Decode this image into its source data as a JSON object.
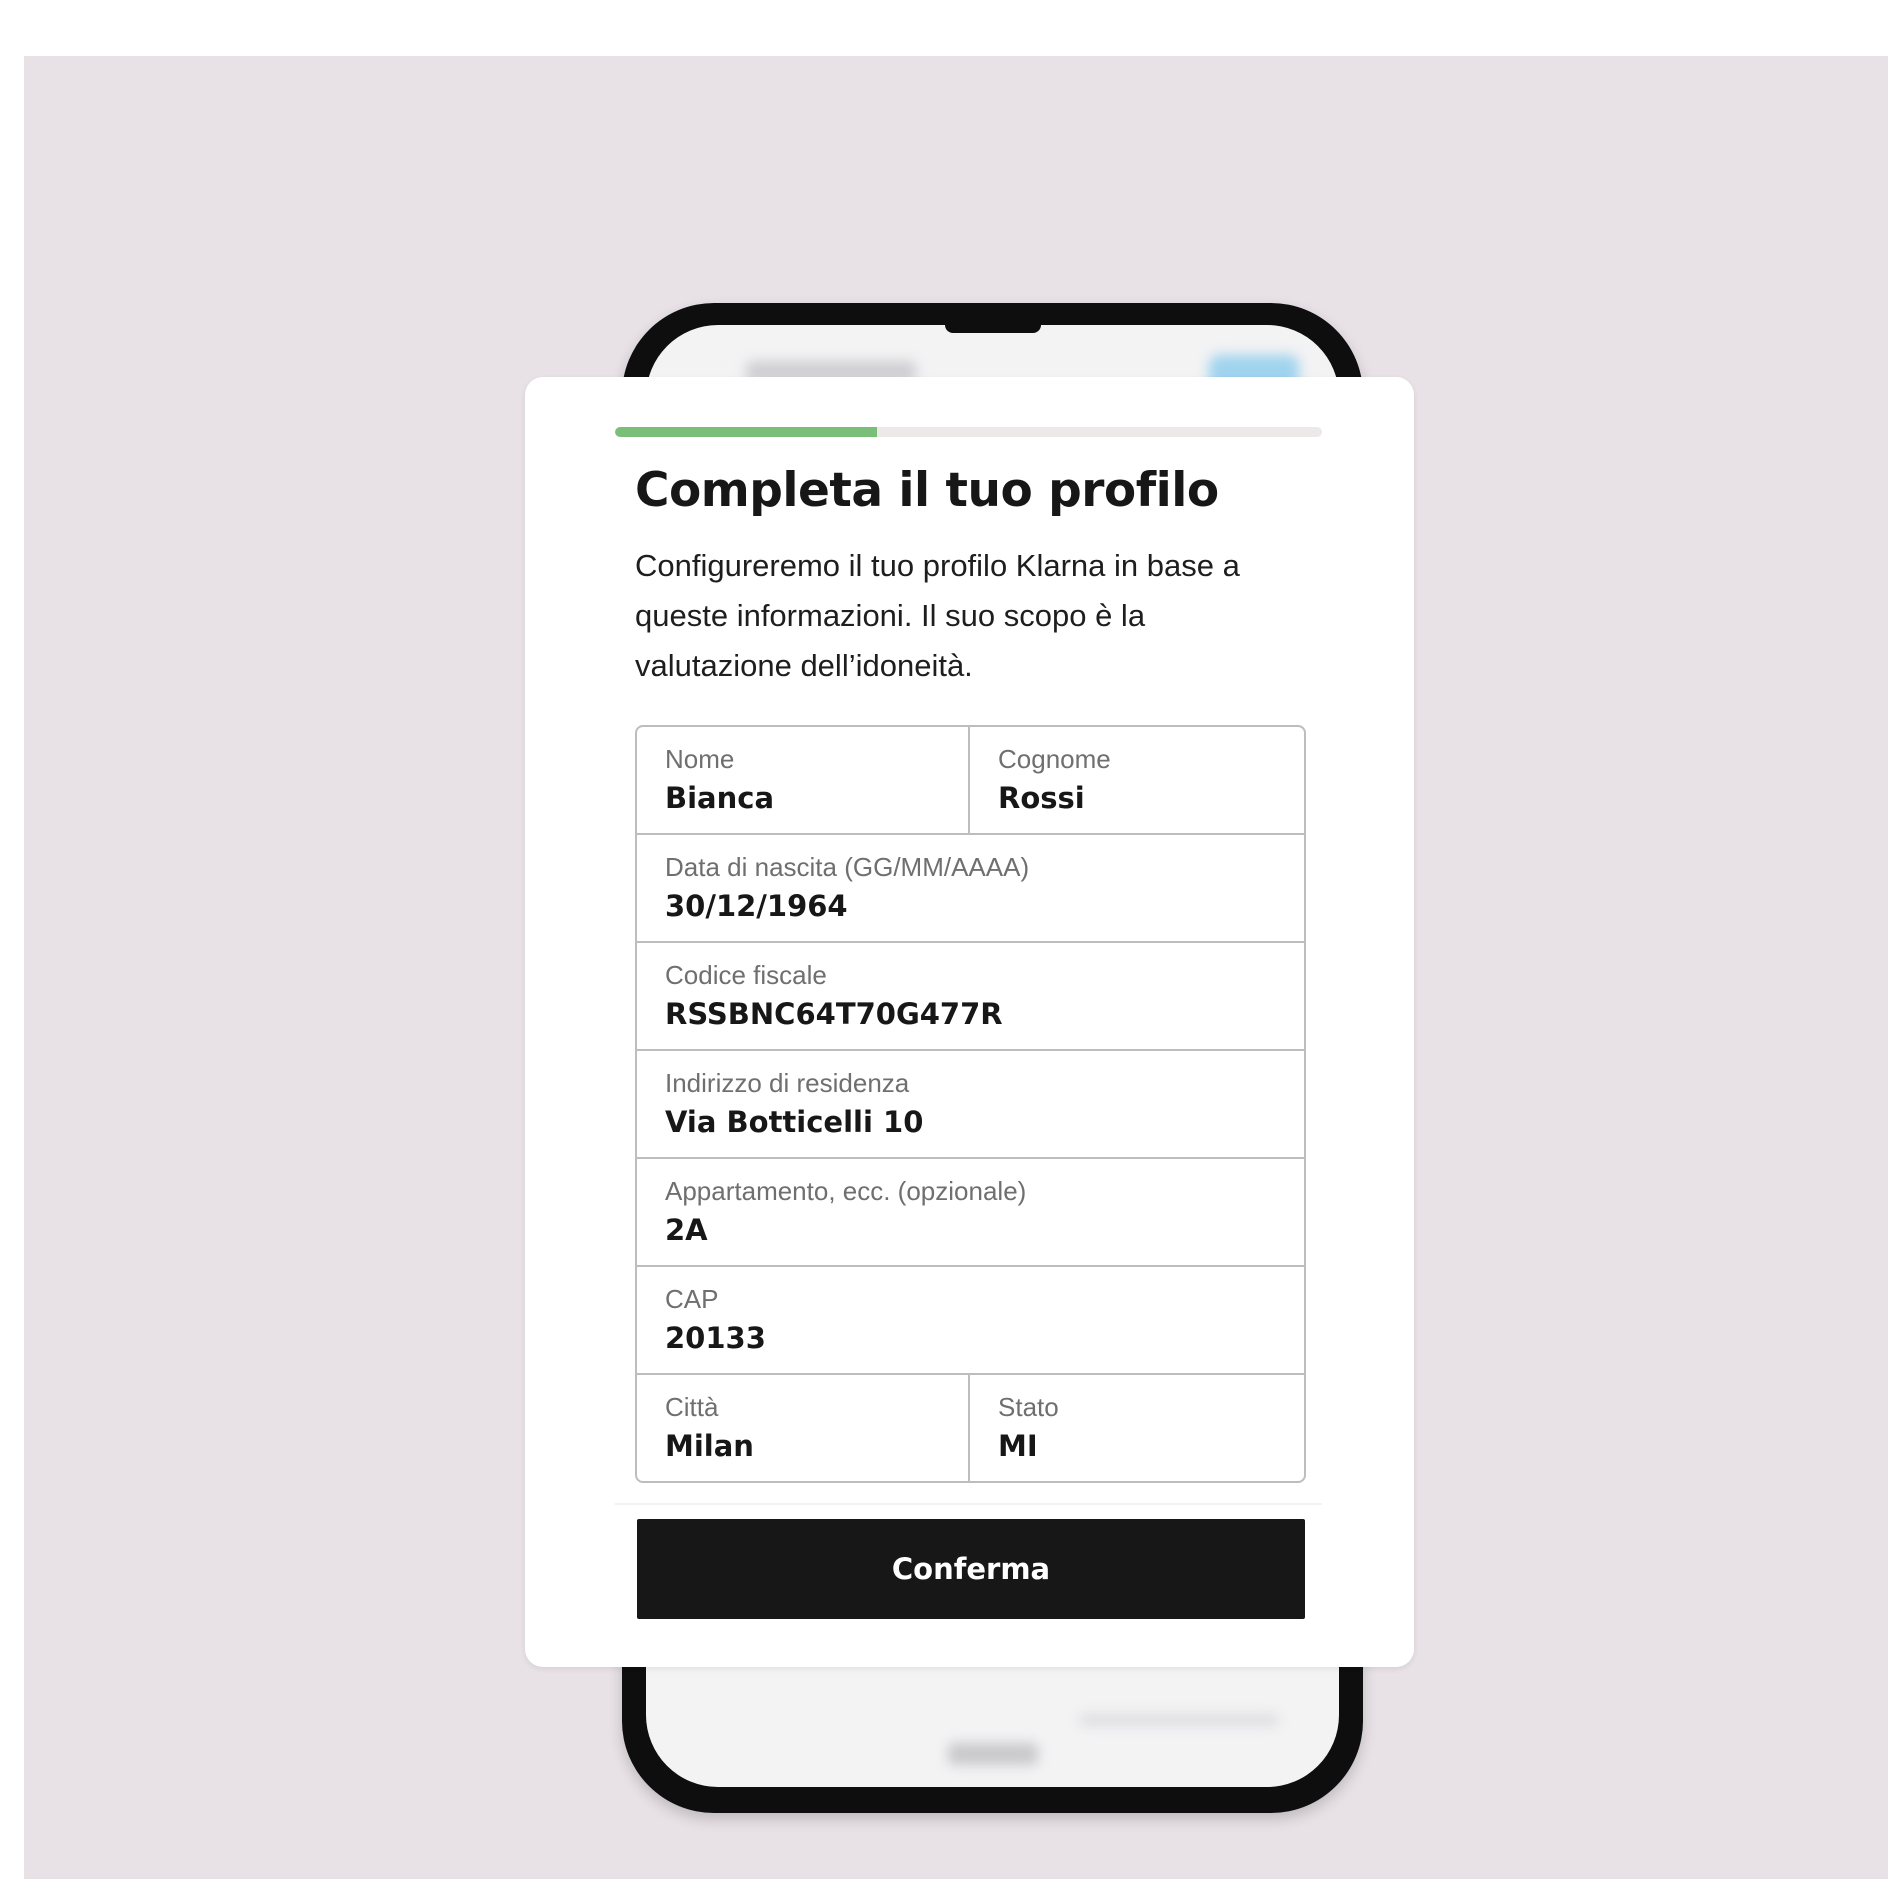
{
  "progress": {
    "fraction": 0.37,
    "color": "#7bbe78"
  },
  "header": {
    "title": "Completa il tuo profilo",
    "subtitle": "Configureremo il tuo profilo Klarna in base a queste informazioni. Il suo scopo è la valutazione dell’idoneità."
  },
  "form": {
    "first_name": {
      "label": "Nome",
      "value": "Bianca"
    },
    "last_name": {
      "label": "Cognome",
      "value": "Rossi"
    },
    "birth_date": {
      "label": "Data di nascita (GG/MM/AAAA)",
      "value": "30/12/1964"
    },
    "tax_code": {
      "label": "Codice fiscale",
      "value": "RSSBNC64T70G477R"
    },
    "address": {
      "label": "Indirizzo di residenza",
      "value": "Via Botticelli 10"
    },
    "apartment": {
      "label": "Appartamento, ecc. (opzionale)",
      "value": "2A"
    },
    "postal_code": {
      "label": "CAP",
      "value": "20133"
    },
    "city": {
      "label": "Città",
      "value": "Milan"
    },
    "state": {
      "label": "Stato",
      "value": "MI"
    }
  },
  "actions": {
    "confirm_label": "Conferma"
  }
}
